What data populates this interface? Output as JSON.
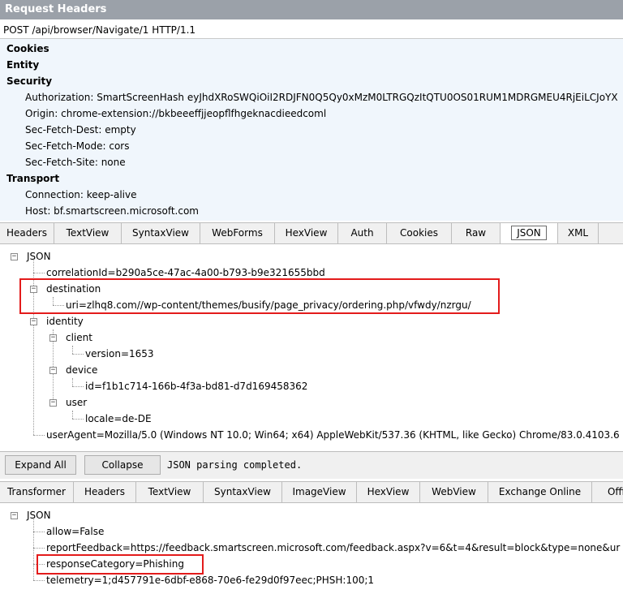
{
  "request": {
    "title": "Request Headers",
    "request_line": "POST /api/browser/Navigate/1 HTTP/1.1",
    "groups": [
      "Cookies",
      "Entity",
      "Security",
      "Transport"
    ],
    "security": [
      "Authorization: SmartScreenHash eyJhdXRoSWQiOiI2RDJFN0Q5Qy0xMzM0LTRGQzItQTU0OS01RUM1MDRGMEU4RjEiLCJoYX",
      "Origin: chrome-extension://bkbeeeffjjeopflfhgeknacdieedcoml",
      "Sec-Fetch-Dest: empty",
      "Sec-Fetch-Mode: cors",
      "Sec-Fetch-Site: none"
    ],
    "transport": [
      "Connection: keep-alive",
      "Host: bf.smartscreen.microsoft.com"
    ]
  },
  "request_tabs": [
    "Headers",
    "TextView",
    "SyntaxView",
    "WebForms",
    "HexView",
    "Auth",
    "Cookies",
    "Raw",
    "JSON",
    "XML"
  ],
  "request_tree": {
    "root": "JSON",
    "correlation": "correlationId=b290a5ce-47ac-4a00-b793-b9e321655bbd",
    "destination": "destination",
    "uri": "uri=zlhq8.com//wp-content/themes/busify/page_privacy/ordering.php/vfwdy/nzrgu/",
    "identity": "identity",
    "client": "client",
    "version": "version=1653",
    "device": "device",
    "device_id": "id=f1b1c714-166b-4f3a-bd81-d7d169458362",
    "user": "user",
    "locale": "locale=de-DE",
    "user_agent": "userAgent=Mozilla/5.0 (Windows NT 10.0; Win64; x64) AppleWebKit/537.36 (KHTML, like Gecko) Chrome/83.0.4103.6"
  },
  "actions": {
    "expand_all": "Expand All",
    "collapse": "Collapse",
    "status": "JSON parsing completed."
  },
  "response_tabs": [
    "Transformer",
    "Headers",
    "TextView",
    "SyntaxView",
    "ImageView",
    "HexView",
    "WebView",
    "Exchange Online",
    "Offi"
  ],
  "response_tree": {
    "root": "JSON",
    "allow": "allow=False",
    "report": "reportFeedback=https://feedback.smartscreen.microsoft.com/feedback.aspx?v=6&t=4&result=block&type=none&ur",
    "category": "responseCategory=Phishing",
    "telemetry": "telemetry=1;d457791e-6dbf-e868-70e6-fe29d0f97eec;PHSH:100;1"
  },
  "colors": {
    "highlight": "#e31b1b",
    "header_bg": "#9ba1a9",
    "headers_panel_bg": "#f0f6fc"
  }
}
